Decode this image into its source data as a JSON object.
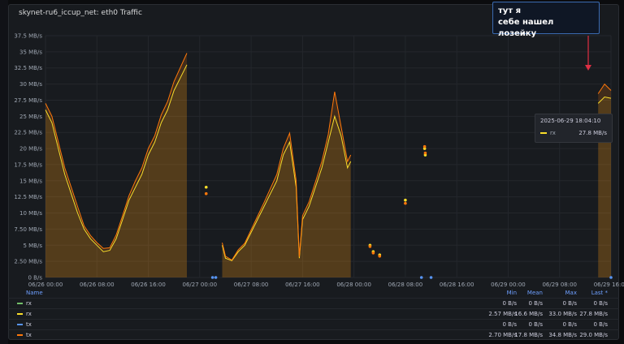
{
  "panel": {
    "title": "skynet-ru6_iccup_net: eth0 Traffic"
  },
  "annotation": {
    "line1": "тут я",
    "line2": "себе нашел лозейку",
    "arrow_color": "#e02f44"
  },
  "tooltip": {
    "time": "2025-06-29 18:04:10",
    "series": "rx",
    "value": "27.8 MB/s"
  },
  "legend": {
    "headers": {
      "name": "Name",
      "min": "Min",
      "mean": "Mean",
      "max": "Max",
      "last": "Last *"
    },
    "rows": [
      {
        "name": "rx",
        "color": "#73bf69",
        "min": "0 B/s",
        "mean": "0 B/s",
        "max": "0 B/s",
        "last": "0 B/s"
      },
      {
        "name": "rx",
        "color": "#fade2a",
        "min": "2.57 MB/s",
        "mean": "16.6 MB/s",
        "max": "33.0 MB/s",
        "last": "27.8 MB/s"
      },
      {
        "name": "tx",
        "color": "#5794f2",
        "min": "0 B/s",
        "mean": "0 B/s",
        "max": "0 B/s",
        "last": "0 B/s"
      },
      {
        "name": "tx",
        "color": "#ff780a",
        "min": "2.70 MB/s",
        "mean": "17.8 MB/s",
        "max": "34.8 MB/s",
        "last": "29.0 MB/s"
      }
    ]
  },
  "chart_data": {
    "type": "area",
    "title": "skynet-ru6_iccup_net: eth0 Traffic",
    "xlabel": "",
    "ylabel": "",
    "y_unit": "MB/s",
    "ylim": [
      0,
      37.5
    ],
    "yticks": [
      "0 B/s",
      "2.50 MB/s",
      "5 MB/s",
      "7.50 MB/s",
      "10 MB/s",
      "12.5 MB/s",
      "15 MB/s",
      "17.5 MB/s",
      "20 MB/s",
      "22.5 MB/s",
      "25 MB/s",
      "27.5 MB/s",
      "30 MB/s",
      "32.5 MB/s",
      "35 MB/s",
      "37.5 MB/s"
    ],
    "xticks": [
      "06/26 00:00",
      "06/26 08:00",
      "06/26 16:00",
      "06/27 00:00",
      "06/27 08:00",
      "06/27 16:00",
      "06/28 00:00",
      "06/28 08:00",
      "06/28 16:00",
      "06/29 00:00",
      "06/29 08:00",
      "06/29 16:00"
    ],
    "x_hours_range": [
      0,
      88
    ],
    "grid": true,
    "legend_position": "bottom",
    "series": [
      {
        "name": "rx",
        "color": "#fade2a",
        "segments": [
          [
            [
              0,
              26
            ],
            [
              1,
              24
            ],
            [
              2,
              20
            ],
            [
              3,
              16
            ],
            [
              4,
              13
            ],
            [
              5,
              10
            ],
            [
              6,
              7.5
            ],
            [
              7,
              6
            ],
            [
              8,
              5
            ],
            [
              9,
              4
            ],
            [
              10,
              4.2
            ],
            [
              11,
              6
            ],
            [
              12,
              9
            ],
            [
              13,
              12
            ],
            [
              14,
              14
            ],
            [
              15,
              16
            ],
            [
              16,
              19
            ],
            [
              17,
              21
            ],
            [
              18,
              24
            ],
            [
              19,
              26
            ],
            [
              20,
              29
            ],
            [
              21,
              31
            ],
            [
              22,
              33
            ]
          ],
          [
            [
              27.5,
              5
            ],
            [
              28,
              3
            ],
            [
              29,
              2.6
            ],
            [
              30,
              4
            ],
            [
              31,
              5
            ],
            [
              32,
              7
            ],
            [
              33,
              9
            ],
            [
              34,
              11
            ],
            [
              35,
              13
            ],
            [
              36,
              15
            ],
            [
              37,
              19
            ],
            [
              38,
              21
            ],
            [
              39,
              14
            ],
            [
              39.5,
              3
            ],
            [
              40,
              9
            ],
            [
              41,
              11
            ],
            [
              42,
              14
            ],
            [
              43,
              17
            ],
            [
              44,
              21
            ],
            [
              45,
              25
            ],
            [
              46,
              22
            ],
            [
              47,
              17
            ],
            [
              47.5,
              18
            ]
          ],
          [
            [
              86,
              27
            ],
            [
              87,
              28
            ],
            [
              88,
              27.8
            ]
          ]
        ],
        "dots": [
          [
            25,
            14
          ],
          [
            50.5,
            5
          ],
          [
            51,
            4
          ],
          [
            52,
            3.5
          ],
          [
            56,
            12
          ],
          [
            59,
            20
          ],
          [
            59.1,
            19
          ]
        ]
      },
      {
        "name": "tx",
        "color": "#ff780a",
        "segments": [
          [
            [
              0,
              27
            ],
            [
              1,
              25
            ],
            [
              2,
              21
            ],
            [
              3,
              17
            ],
            [
              4,
              14
            ],
            [
              5,
              11
            ],
            [
              6,
              8
            ],
            [
              7,
              6.5
            ],
            [
              8,
              5.4
            ],
            [
              9,
              4.5
            ],
            [
              10,
              4.6
            ],
            [
              11,
              6.6
            ],
            [
              12,
              9.6
            ],
            [
              13,
              12.7
            ],
            [
              14,
              15
            ],
            [
              15,
              17
            ],
            [
              16,
              20
            ],
            [
              17,
              22
            ],
            [
              18,
              25.2
            ],
            [
              19,
              27.3
            ],
            [
              20,
              30.4
            ],
            [
              21,
              32.6
            ],
            [
              22,
              34.8
            ]
          ],
          [
            [
              27.5,
              5.4
            ],
            [
              28,
              3.3
            ],
            [
              29,
              2.7
            ],
            [
              30,
              4.3
            ],
            [
              31,
              5.3
            ],
            [
              32,
              7.4
            ],
            [
              33,
              9.5
            ],
            [
              34,
              11.6
            ],
            [
              35,
              13.8
            ],
            [
              36,
              16
            ],
            [
              37,
              20
            ],
            [
              38,
              22.4
            ],
            [
              39,
              15
            ],
            [
              39.5,
              3.2
            ],
            [
              40,
              9.6
            ],
            [
              41,
              11.7
            ],
            [
              42,
              14.8
            ],
            [
              43,
              18
            ],
            [
              44,
              22.2
            ],
            [
              45,
              28.8
            ],
            [
              46,
              23.4
            ],
            [
              47,
              18
            ],
            [
              47.5,
              19
            ]
          ],
          [
            [
              86,
              28.5
            ],
            [
              87,
              30
            ],
            [
              88,
              29
            ]
          ]
        ],
        "dots": [
          [
            25,
            13
          ],
          [
            50.5,
            4.8
          ],
          [
            51,
            3.8
          ],
          [
            52,
            3.3
          ],
          [
            56,
            11.5
          ],
          [
            59,
            20.3
          ],
          [
            59.1,
            19.3
          ]
        ]
      },
      {
        "name": "tx",
        "color": "#5794f2",
        "segments": [],
        "dots": [
          [
            26,
            0
          ],
          [
            26.5,
            0
          ],
          [
            58.5,
            0
          ],
          [
            60,
            0
          ],
          [
            88,
            0
          ]
        ]
      }
    ]
  }
}
